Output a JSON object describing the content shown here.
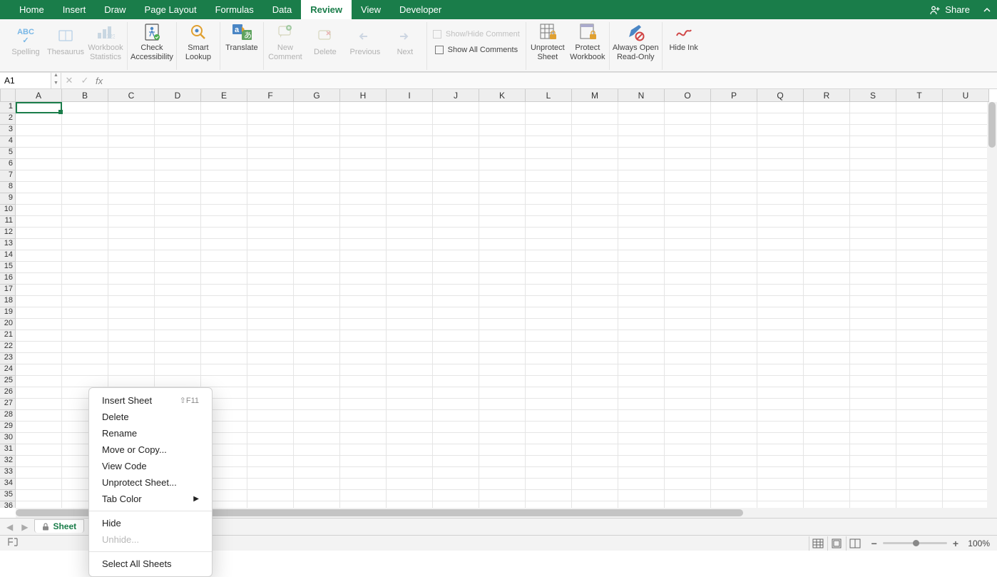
{
  "tabs": [
    "Home",
    "Insert",
    "Draw",
    "Page Layout",
    "Formulas",
    "Data",
    "Review",
    "View",
    "Developer"
  ],
  "active_tab_index": 6,
  "share_label": "Share",
  "ribbon": {
    "spelling": "Spelling",
    "thesaurus": "Thesaurus",
    "workbook_stats": "Workbook\nStatistics",
    "check_access": "Check\nAccessibility",
    "smart_lookup": "Smart\nLookup",
    "translate": "Translate",
    "new_comment": "New\nComment",
    "delete": "Delete",
    "previous": "Previous",
    "next": "Next",
    "show_hide_comment": "Show/Hide Comment",
    "show_all_comments": "Show All Comments",
    "unprotect_sheet": "Unprotect\nSheet",
    "protect_workbook": "Protect\nWorkbook",
    "always_read_only": "Always Open\nRead-Only",
    "hide_ink": "Hide Ink"
  },
  "name_box_value": "A1",
  "fx_label": "fx",
  "columns": [
    "A",
    "B",
    "C",
    "D",
    "E",
    "F",
    "G",
    "H",
    "I",
    "J",
    "K",
    "L",
    "M",
    "N",
    "O",
    "P",
    "Q",
    "R",
    "S",
    "T",
    "U"
  ],
  "row_count": 36,
  "sheet_tab_label": "Sheet",
  "context_menu": {
    "insert": "Insert Sheet",
    "insert_shortcut": "⇧F11",
    "delete": "Delete",
    "rename": "Rename",
    "move_copy": "Move or Copy...",
    "view_code": "View Code",
    "unprotect": "Unprotect Sheet...",
    "tab_color": "Tab Color",
    "hide": "Hide",
    "unhide": "Unhide...",
    "select_all": "Select All Sheets"
  },
  "zoom_label": "100%"
}
